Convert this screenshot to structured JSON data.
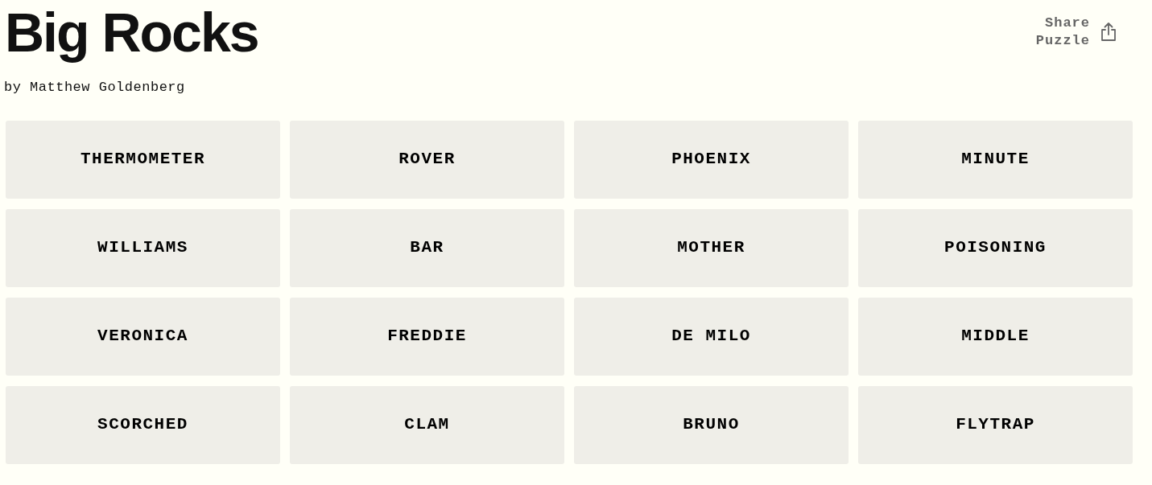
{
  "title": "Big Rocks",
  "byline": "by Matthew Goldenberg",
  "share": {
    "label": "Share Puzzle"
  },
  "tiles": [
    {
      "word": "THERMOMETER"
    },
    {
      "word": "ROVER"
    },
    {
      "word": "PHOENIX"
    },
    {
      "word": "MINUTE"
    },
    {
      "word": "WILLIAMS"
    },
    {
      "word": "BAR"
    },
    {
      "word": "MOTHER"
    },
    {
      "word": "POISONING"
    },
    {
      "word": "VERONICA"
    },
    {
      "word": "FREDDIE"
    },
    {
      "word": "DE MILO"
    },
    {
      "word": "MIDDLE"
    },
    {
      "word": "SCORCHED"
    },
    {
      "word": "CLAM"
    },
    {
      "word": "BRUNO"
    },
    {
      "word": "FLYTRAP"
    }
  ]
}
